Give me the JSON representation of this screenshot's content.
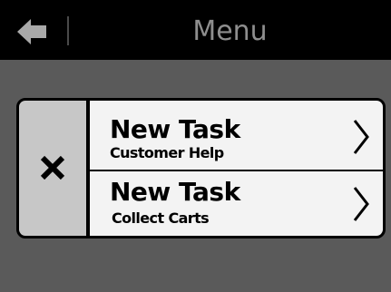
{
  "header": {
    "title": "Menu"
  },
  "icons": {
    "back": "arrow-left-icon",
    "close": "close-icon",
    "chevron": "chevron-right-icon"
  },
  "tasks": [
    {
      "title": "New Task",
      "subtitle": "Customer Help"
    },
    {
      "title": "New Task",
      "subtitle": "Collect Carts"
    }
  ],
  "colors": {
    "header_bg": "#000000",
    "page_bg": "#5a5a5a",
    "close_bg": "#c7c7c7",
    "task_bg": "#f3f3f3",
    "title_text": "#8e8e8e"
  }
}
